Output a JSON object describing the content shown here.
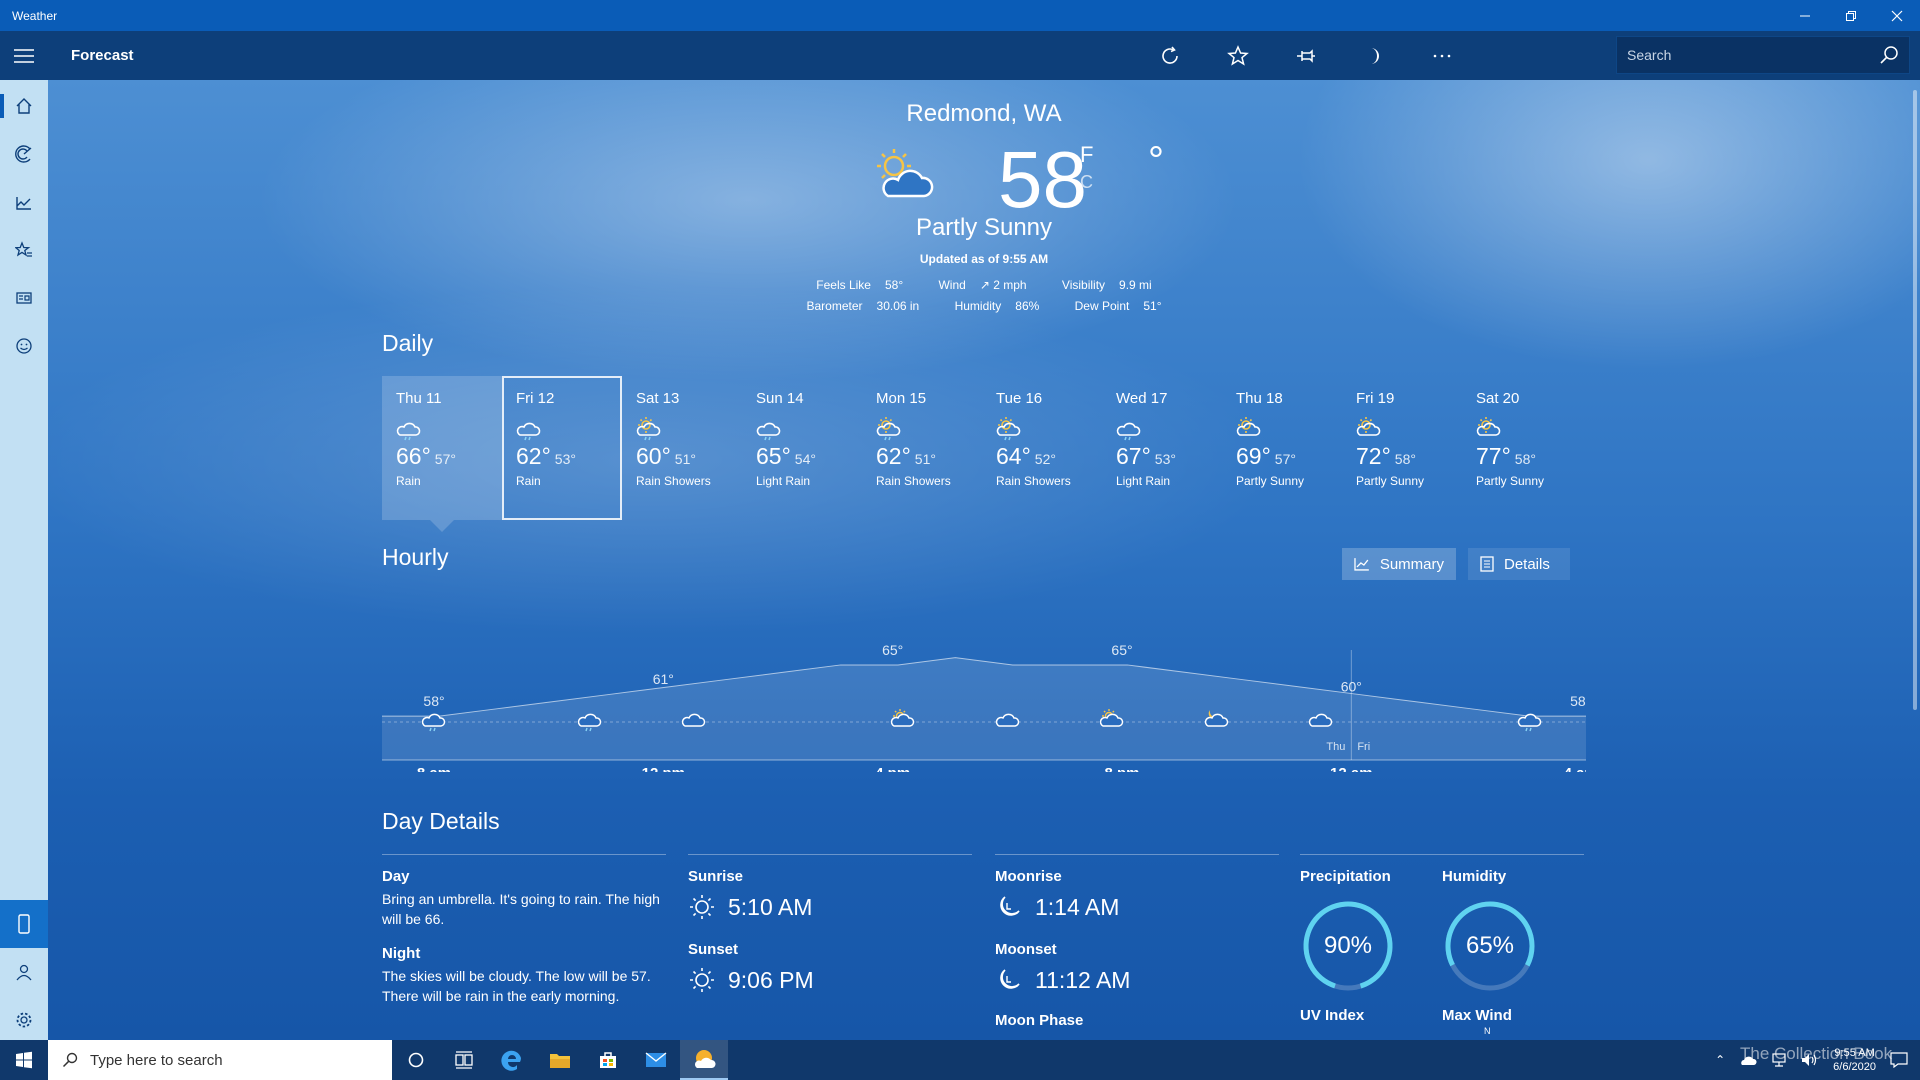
{
  "window": {
    "title": "Weather"
  },
  "header": {
    "title": "Forecast"
  },
  "search": {
    "placeholder": "Search"
  },
  "current": {
    "location": "Redmond, WA",
    "temperature": "58",
    "degree": "°",
    "unit_f": "F",
    "unit_c": "C",
    "condition": "Partly Sunny",
    "updated": "Updated as of 9:55 AM",
    "stats_row1": [
      {
        "label": "Feels Like",
        "value": "58°"
      },
      {
        "label": "Wind",
        "value": "↗ 2 mph"
      },
      {
        "label": "Visibility",
        "value": "9.9 mi"
      }
    ],
    "stats_row2": [
      {
        "label": "Barometer",
        "value": "30.06 in"
      },
      {
        "label": "Humidity",
        "value": "86%"
      },
      {
        "label": "Dew Point",
        "value": "51°"
      }
    ]
  },
  "daily": {
    "title": "Daily",
    "days": [
      {
        "name": "Thu 11",
        "hi": "66°",
        "lo": "57°",
        "cond": "Rain",
        "icon": "rain-icon"
      },
      {
        "name": "Fri 12",
        "hi": "62°",
        "lo": "53°",
        "cond": "Rain",
        "icon": "rain-icon"
      },
      {
        "name": "Sat 13",
        "hi": "60°",
        "lo": "51°",
        "cond": "Rain Showers",
        "icon": "sun-shower-icon"
      },
      {
        "name": "Sun 14",
        "hi": "65°",
        "lo": "54°",
        "cond": "Light Rain",
        "icon": "rain-icon"
      },
      {
        "name": "Mon 15",
        "hi": "62°",
        "lo": "51°",
        "cond": "Rain Showers",
        "icon": "sun-shower-icon"
      },
      {
        "name": "Tue 16",
        "hi": "64°",
        "lo": "52°",
        "cond": "Rain Showers",
        "icon": "sun-shower-icon"
      },
      {
        "name": "Wed 17",
        "hi": "67°",
        "lo": "53°",
        "cond": "Light Rain",
        "icon": "rain-icon"
      },
      {
        "name": "Thu 18",
        "hi": "69°",
        "lo": "57°",
        "cond": "Partly Sunny",
        "icon": "partly-sunny-icon"
      },
      {
        "name": "Fri 19",
        "hi": "72°",
        "lo": "58°",
        "cond": "Partly Sunny",
        "icon": "partly-sunny-icon"
      },
      {
        "name": "Sat 20",
        "hi": "77°",
        "lo": "58°",
        "cond": "Partly Sunny",
        "icon": "partly-sunny-icon"
      }
    ]
  },
  "hourly": {
    "title": "Hourly",
    "summary_label": "Summary",
    "details_label": "Details",
    "time_labels": [
      "8 am",
      "12 pm",
      "4 pm",
      "8 pm",
      "12 am",
      "4 am"
    ],
    "temp_labels": [
      "58°",
      "61°",
      "65°",
      "65°",
      "60°",
      "58°"
    ],
    "divider_left": "Thu",
    "divider_right": "Fri"
  },
  "chart_data": {
    "type": "area",
    "x": [
      "8 am",
      "9 am",
      "10 am",
      "11 am",
      "12 pm",
      "1 pm",
      "2 pm",
      "3 pm",
      "4 pm",
      "5 pm",
      "6 pm",
      "7 pm",
      "8 pm",
      "9 pm",
      "10 pm",
      "11 pm",
      "12 am",
      "1 am",
      "2 am",
      "3 am",
      "4 am",
      "5 am"
    ],
    "values": [
      58,
      58,
      59,
      60,
      61,
      62,
      63,
      64,
      65,
      65,
      66,
      65,
      65,
      65,
      64,
      63,
      62,
      61,
      60,
      59,
      58,
      58
    ],
    "labeled_points": [
      {
        "x": "8 am",
        "y": 58
      },
      {
        "x": "12 pm",
        "y": 61
      },
      {
        "x": "4 pm",
        "y": 65
      },
      {
        "x": "8 pm",
        "y": 65
      },
      {
        "x": "12 am",
        "y": 60
      },
      {
        "x": "4 am",
        "y": 58
      }
    ],
    "icons": [
      "rain-icon",
      "rain-icon",
      "cloud-icon",
      "partly-sunny-icon",
      "cloud-icon",
      "partly-sunny-icon",
      "partly-night-icon",
      "cloud-icon",
      "rain-icon"
    ],
    "ylim": [
      52,
      68
    ]
  },
  "day_details": {
    "title": "Day Details",
    "day_label": "Day",
    "day_text": "Bring an umbrella. It's going to rain. The high will be 66.",
    "night_label": "Night",
    "night_text": "The skies will be cloudy. The low will be 57. There will be rain in the early morning.",
    "sunrise_label": "Sunrise",
    "sunrise": "5:10 AM",
    "sunset_label": "Sunset",
    "sunset": "9:06 PM",
    "moonrise_label": "Moonrise",
    "moonrise": "1:14 AM",
    "moonset_label": "Moonset",
    "moonset": "11:12 AM",
    "moonphase_label": "Moon Phase",
    "precip_label": "Precipitation",
    "precip_value": "90%",
    "precip_fraction": 0.9,
    "humidity_label": "Humidity",
    "humidity_value": "65%",
    "humidity_fraction": 0.65,
    "uv_label": "UV Index",
    "wind_label": "Max Wind",
    "wind_dir": "N"
  },
  "taskbar": {
    "search_text": "Type here to search",
    "time": "9:55 AM",
    "date": "6/6/2020",
    "watermark": "The Collection Book"
  },
  "colors": {
    "titlebar": "#0a5cb7",
    "header": "#0d3f7a",
    "rail": "#c2e0f3",
    "ring": "#5fd3f0"
  }
}
